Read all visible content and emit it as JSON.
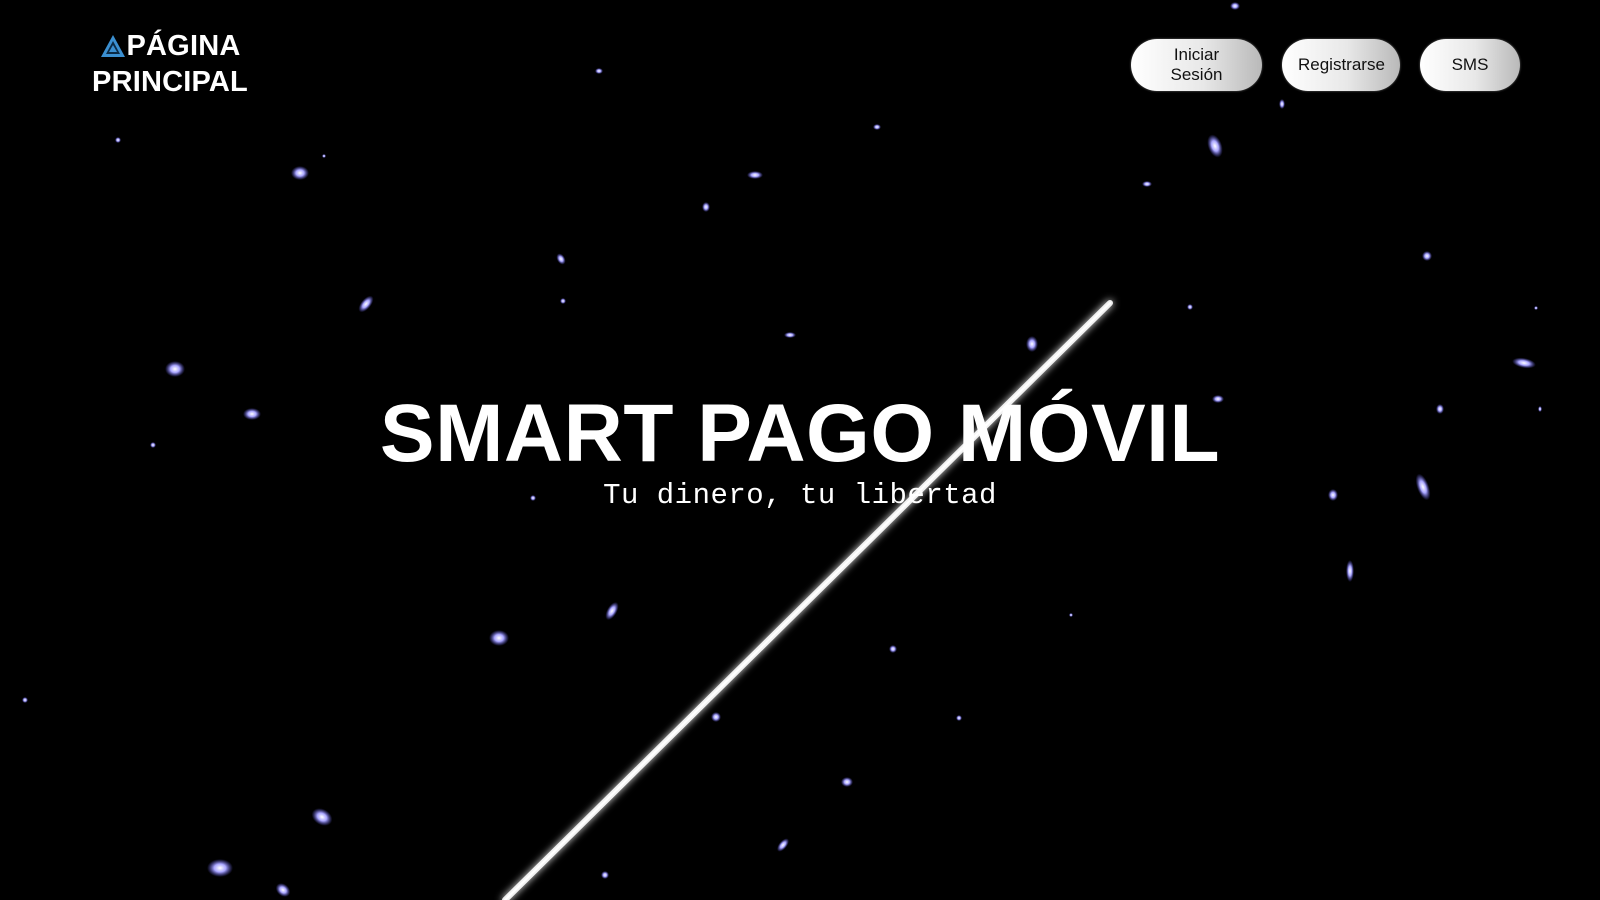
{
  "header": {
    "logo_line1": "PÁGINA",
    "logo_line2": "PRINCIPAL",
    "logo_icon": "triangle-logo-icon",
    "nav": {
      "login_label": "Iniciar Sesión",
      "register_label": "Registrarse",
      "sms_label": "SMS"
    }
  },
  "hero": {
    "title": "SMART PAGO MÓVIL",
    "subtitle": "Tu dinero, tu libertad"
  },
  "colors": {
    "background": "#000000",
    "particles": "#8a86f0",
    "logo_icon": "#3b8fd0",
    "text": "#ffffff"
  }
}
